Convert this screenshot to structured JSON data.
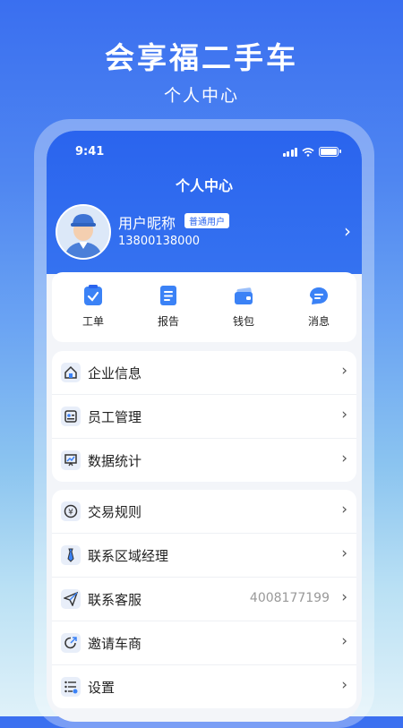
{
  "promo": {
    "title": "会享福二手车",
    "subtitle": "个人中心"
  },
  "status_bar": {
    "time": "9:41"
  },
  "header": {
    "title": "个人中心",
    "nickname": "用户昵称",
    "badge": "普通用户",
    "phone": "13800138000",
    "arrow": "›"
  },
  "quick_actions": [
    {
      "label": "工单",
      "icon": "work-order-icon"
    },
    {
      "label": "报告",
      "icon": "report-icon"
    },
    {
      "label": "钱包",
      "icon": "wallet-icon"
    },
    {
      "label": "消息",
      "icon": "message-icon"
    }
  ],
  "menu_group_1": [
    {
      "label": "企业信息",
      "icon": "home-icon"
    },
    {
      "label": "员工管理",
      "icon": "staff-card-icon"
    },
    {
      "label": "数据统计",
      "icon": "chart-icon"
    }
  ],
  "menu_group_2": [
    {
      "label": "交易规则",
      "icon": "yuan-icon"
    },
    {
      "label": "联系区域经理",
      "icon": "tie-icon"
    },
    {
      "label": "联系客服",
      "icon": "send-icon",
      "value": "4008177199"
    },
    {
      "label": "邀请车商",
      "icon": "invite-icon"
    },
    {
      "label": "设置",
      "icon": "settings-list-icon"
    }
  ],
  "arrow": "›",
  "colors": {
    "primary": "#2a64ee",
    "accent": "#3b82f6"
  }
}
